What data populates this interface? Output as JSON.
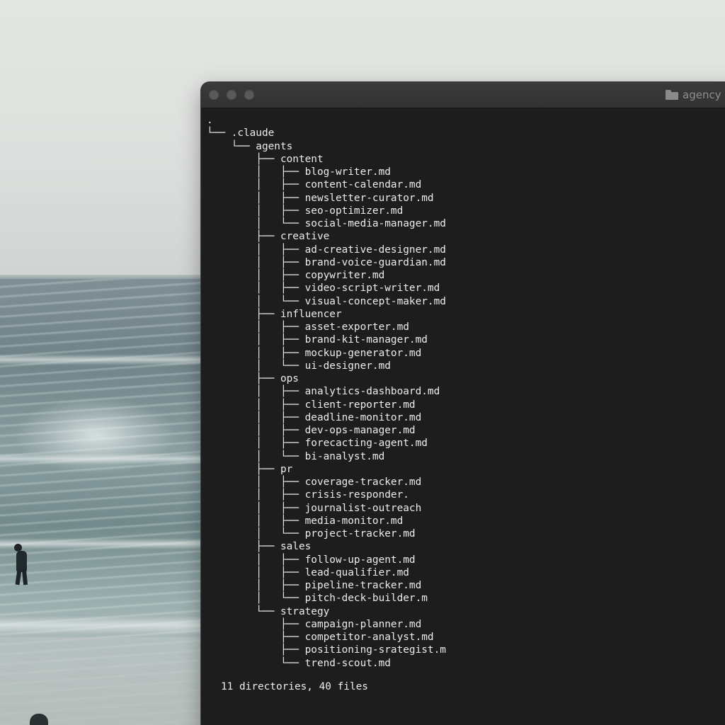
{
  "window": {
    "title": "agency"
  },
  "terminal": {
    "tree_lines": [
      ".",
      "└── .claude",
      "    └── agents",
      "        ├── content",
      "        │   ├── blog-writer.md",
      "        │   ├── content-calendar.md",
      "        │   ├── newsletter-curator.md",
      "        │   ├── seo-optimizer.md",
      "        │   └── social-media-manager.md",
      "        ├── creative",
      "        │   ├── ad-creative-designer.md",
      "        │   ├── brand-voice-guardian.md",
      "        │   ├── copywriter.md",
      "        │   ├── video-script-writer.md",
      "        │   └── visual-concept-maker.md",
      "        ├── influencer",
      "        │   ├── asset-exporter.md",
      "        │   ├── brand-kit-manager.md",
      "        │   ├── mockup-generator.md",
      "        │   └── ui-designer.md",
      "        ├── ops",
      "        │   ├── analytics-dashboard.md",
      "        │   ├── client-reporter.md",
      "        │   ├── deadline-monitor.md",
      "        │   ├── dev-ops-manager.md",
      "        │   ├── forecacting-agent.md",
      "        │   └── bi-analyst.md",
      "        ├── pr",
      "        │   ├── coverage-tracker.md",
      "        │   ├── crisis-responder.",
      "        │   ├── journalist-outreach",
      "        │   ├── media-monitor.md",
      "        │   └── project-tracker.md",
      "        ├── sales",
      "        │   ├── follow-up-agent.md",
      "        │   ├── lead-qualifier.md",
      "        │   ├── pipeline-tracker.md",
      "        │   └── pitch-deck-builder.m",
      "        └── strategy",
      "            ├── campaign-planner.md",
      "            ├── competitor-analyst.md",
      "            ├── positioning-srategist.m",
      "            └── trend-scout.md"
    ],
    "summary": "11 directories, 40 files"
  }
}
